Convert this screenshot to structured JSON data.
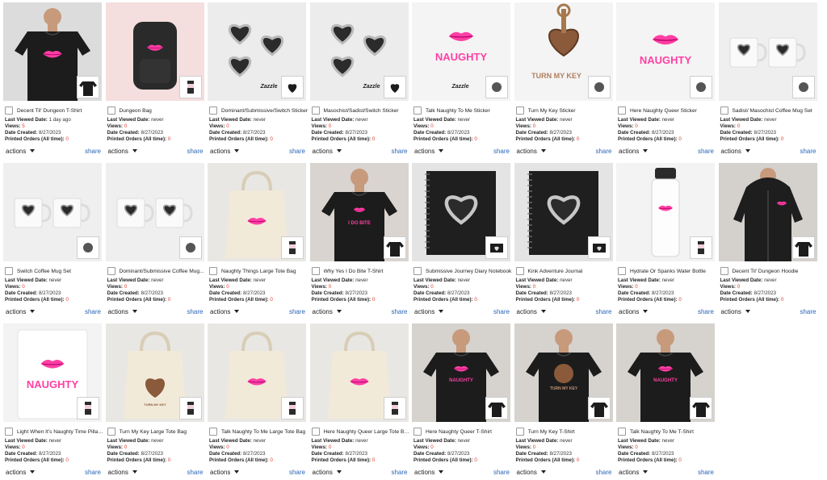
{
  "labels": {
    "last_viewed": "Last Viewed Date:",
    "views": "Views:",
    "date_created": "Date Created:",
    "printed_orders": "Printed Orders (All time):",
    "actions": "actions",
    "share": "share",
    "mini_brand": "Zazzle"
  },
  "products": [
    {
      "title": "Decent Til' Dungeon T-Shirt",
      "last_viewed": "1 day ago",
      "views": "5",
      "date_created": "8/27/2023",
      "printed_orders": "0",
      "art": "shirt-lips"
    },
    {
      "title": "Dungeon Bag",
      "last_viewed": "never",
      "views": "0",
      "date_created": "8/27/2023",
      "printed_orders": "0",
      "art": "backpack"
    },
    {
      "title": "Dominant/Submissive/Switch Sticker",
      "last_viewed": "never",
      "views": "0",
      "date_created": "8/27/2023",
      "printed_orders": "0",
      "art": "hearts"
    },
    {
      "title": "Masochist/Sadist/Switch Sticker",
      "last_viewed": "never",
      "views": "0",
      "date_created": "8/27/2023",
      "printed_orders": "0",
      "art": "hearts"
    },
    {
      "title": "Talk Naughty To Me Sticker",
      "last_viewed": "never",
      "views": "0",
      "date_created": "8/27/2023",
      "printed_orders": "0",
      "art": "naughty-sticker"
    },
    {
      "title": "Turn My Key Sticker",
      "last_viewed": "never",
      "views": "0",
      "date_created": "8/27/2023",
      "printed_orders": "0",
      "art": "key-sticker"
    },
    {
      "title": "Here Naughty Queer Sticker",
      "last_viewed": "never",
      "views": "0",
      "date_created": "8/27/2023",
      "printed_orders": "0",
      "art": "queer-sticker"
    },
    {
      "title": "Sadist/ Masochist Coffee Mug Set",
      "last_viewed": "never",
      "views": "0",
      "date_created": "8/27/2023",
      "printed_orders": "0",
      "art": "mugs"
    },
    {
      "title": "Switch Coffee Mug Set",
      "last_viewed": "never",
      "views": "0",
      "date_created": "8/27/2023",
      "printed_orders": "0",
      "art": "mugs"
    },
    {
      "title": "Dominant/Submissive Coffee Mug...",
      "last_viewed": "never",
      "views": "0",
      "date_created": "8/27/2023",
      "printed_orders": "0",
      "art": "mugs"
    },
    {
      "title": "Naughty Things Large Tote Bag",
      "last_viewed": "never",
      "views": "0",
      "date_created": "8/27/2023",
      "printed_orders": "0",
      "art": "tote-lips"
    },
    {
      "title": "Why Yes I Do Bite T-Shirt",
      "last_viewed": "never",
      "views": "0",
      "date_created": "8/27/2023",
      "printed_orders": "0",
      "art": "shirt-bite"
    },
    {
      "title": "Submissive Journey Diary Notebook",
      "last_viewed": "never",
      "views": "0",
      "date_created": "8/27/2023",
      "printed_orders": "0",
      "art": "notebook"
    },
    {
      "title": "Kink Adventure Journal",
      "last_viewed": "never",
      "views": "0",
      "date_created": "8/27/2023",
      "printed_orders": "0",
      "art": "notebook"
    },
    {
      "title": "Hydrate Or Spanks Water Bottle",
      "last_viewed": "never",
      "views": "0",
      "date_created": "8/27/2023",
      "printed_orders": "0",
      "art": "bottle"
    },
    {
      "title": "Decent Til' Dungeon Hoodie",
      "last_viewed": "never",
      "views": "0",
      "date_created": "8/27/2023",
      "printed_orders": "0",
      "art": "hoodie"
    },
    {
      "title": "Light When It's Naughty Time Pillar...",
      "last_viewed": "never",
      "views": "0",
      "date_created": "8/27/2023",
      "printed_orders": "0",
      "art": "candle"
    },
    {
      "title": "Turn My Key Large Tote Bag",
      "last_viewed": "never",
      "views": "0",
      "date_created": "8/27/2023",
      "printed_orders": "0",
      "art": "tote-key"
    },
    {
      "title": "Talk Naughty To Me Large Tote Bag",
      "last_viewed": "never",
      "views": "0",
      "date_created": "8/27/2023",
      "printed_orders": "0",
      "art": "tote-lips"
    },
    {
      "title": "Here Naughty Queer Large Tote Bag",
      "last_viewed": "never",
      "views": "0",
      "date_created": "8/27/2023",
      "printed_orders": "0",
      "art": "tote-lips"
    },
    {
      "title": "Here Naughty Queer T-Shirt",
      "last_viewed": "never",
      "views": "0",
      "date_created": "8/27/2023",
      "printed_orders": "0",
      "art": "shirt-naughty"
    },
    {
      "title": "Turn My Key T-Shirt",
      "last_viewed": "never",
      "views": "0",
      "date_created": "8/27/2023",
      "printed_orders": "0",
      "art": "shirt-key"
    },
    {
      "title": "Talk Naughty To Me T-Shirt",
      "last_viewed": "never",
      "views": "0",
      "date_created": "8/27/2023",
      "printed_orders": "0",
      "art": "shirt-naughty"
    }
  ],
  "art_text": {
    "naughty": "NAUGHTY",
    "turn_my_key": "TURN MY KEY",
    "i_do_bite": "I DO BITE"
  },
  "colors": {
    "pink": "#ff3fa4",
    "link": "#2a66b8",
    "count_red": "#e23b2e",
    "shirt": "#1c1c1c"
  }
}
